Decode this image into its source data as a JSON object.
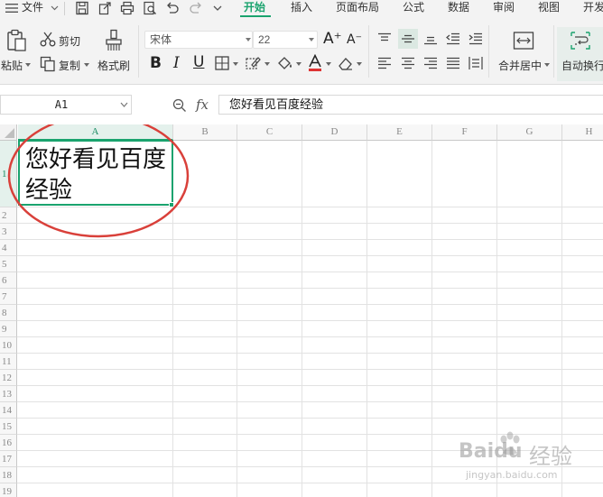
{
  "menubar": {
    "file_label": "文件",
    "tabs": [
      {
        "label": "开始",
        "active": true
      },
      {
        "label": "插入",
        "active": false
      },
      {
        "label": "页面布局",
        "active": false
      },
      {
        "label": "公式",
        "active": false
      },
      {
        "label": "数据",
        "active": false
      },
      {
        "label": "审阅",
        "active": false
      },
      {
        "label": "视图",
        "active": false
      },
      {
        "label": "开发",
        "active": false
      }
    ],
    "quick_access_icons": [
      "save-icon",
      "export-icon",
      "print-icon",
      "print-preview-icon",
      "undo-icon",
      "redo-icon",
      "dropdown-icon"
    ]
  },
  "ribbon": {
    "paste_label": "粘贴",
    "cut_label": "剪切",
    "copy_label": "复制",
    "format_painter_label": "格式刷",
    "font_name": "宋体",
    "font_size": "22",
    "increase_font_label": "A⁺",
    "decrease_font_label": "A⁻",
    "bold_label": "B",
    "italic_label": "I",
    "underline_label": "U",
    "merge_center_label": "合并居中",
    "wrap_text_label": "自动换行"
  },
  "formula_bar": {
    "name_box": "A1",
    "fx_label": "fx",
    "formula_value": "您好看见百度经验"
  },
  "sheet": {
    "columns": [
      "A",
      "B",
      "C",
      "D",
      "E",
      "F",
      "G",
      "H"
    ],
    "rows": [
      "1",
      "2",
      "3",
      "4",
      "5",
      "6",
      "7",
      "8",
      "9",
      "10",
      "11",
      "12",
      "13",
      "14",
      "15",
      "16",
      "17",
      "18",
      "19"
    ],
    "selected_cell": "A1",
    "cell_a1_value": "您好看见百度经验"
  },
  "watermark": {
    "brand": "Baidu",
    "text": "经验",
    "url": "jingyan.baidu.com"
  },
  "colors": {
    "accent": "#1aa36e",
    "annotation": "#d9403a"
  }
}
